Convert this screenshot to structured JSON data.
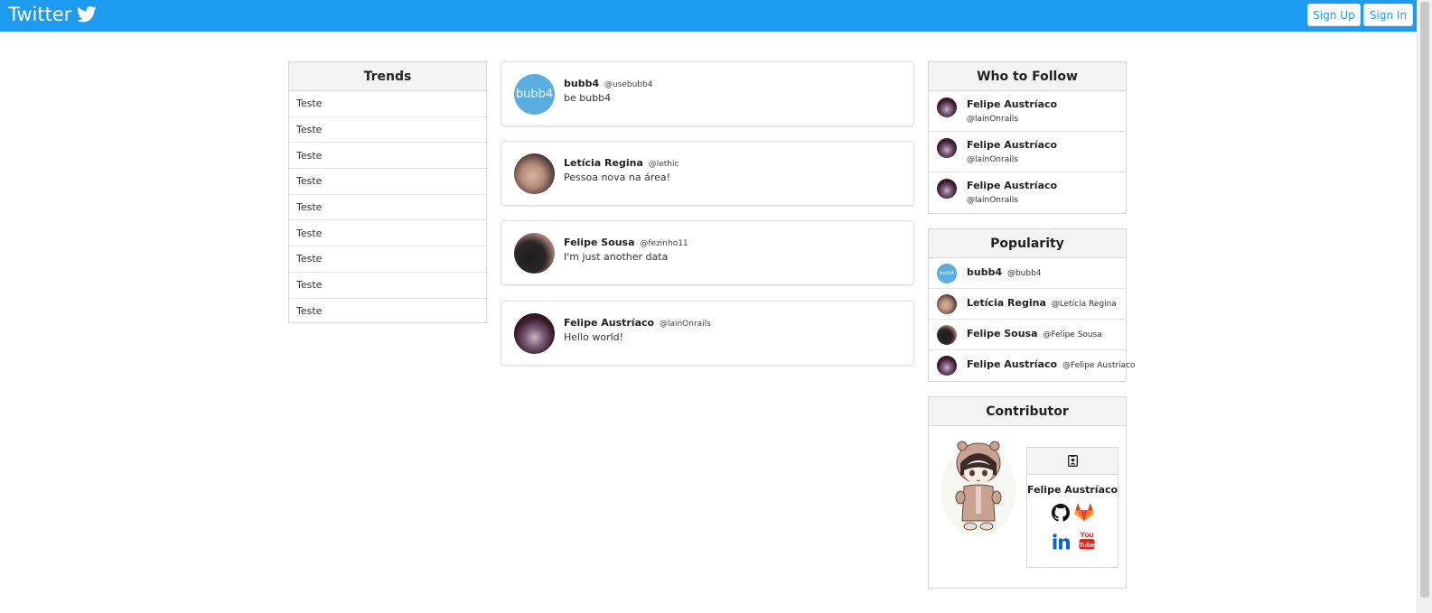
{
  "navbar": {
    "brand": "Twitter",
    "brand_icon": "twitter-bird-icon",
    "signup_label": "Sign Up",
    "signin_label": "Sign In"
  },
  "trends": {
    "title": "Trends",
    "items": [
      "Teste",
      "Teste",
      "Teste",
      "Teste",
      "Teste",
      "Teste",
      "Teste",
      "Teste",
      "Teste"
    ]
  },
  "tweets": [
    {
      "name": "bubb4",
      "handle": "@usebubb4",
      "text": "be bubb4",
      "avatar_text": "bubb4"
    },
    {
      "name": "Letícia Regina",
      "handle": "@lethic",
      "text": "Pessoa nova na área!"
    },
    {
      "name": "Felipe Sousa",
      "handle": "@fezinho11",
      "text": "I'm just another data"
    },
    {
      "name": "Felipe Austríaco",
      "handle": "@lainOnrails",
      "text": "Hello world!"
    }
  ],
  "who_to_follow": {
    "title": "Who to Follow",
    "items": [
      {
        "name": "Felipe Austríaco",
        "handle": "@lainOnrails"
      },
      {
        "name": "Felipe Austríaco",
        "handle": "@lainOnrails"
      },
      {
        "name": "Felipe Austríaco",
        "handle": "@lainOnrails"
      }
    ]
  },
  "popularity": {
    "title": "Popularity",
    "items": [
      {
        "name": "bubb4",
        "handle": "@bubb4"
      },
      {
        "name": "Letícia Regina",
        "handle": "@Letícia Regina"
      },
      {
        "name": "Felipe Sousa",
        "handle": "@Felipe Sousa"
      },
      {
        "name": "Felipe Austríaco",
        "handle": "@Felipe Austríaco"
      }
    ]
  },
  "contributor": {
    "title": "Contributor",
    "card_icon": "contact-card-icon",
    "name": "Felipe Austríaco",
    "socials": [
      "github-icon",
      "gitlab-icon",
      "linkedin-icon",
      "youtube-icon"
    ],
    "youtube_label_top": "You",
    "youtube_label_bottom": "Tube"
  },
  "colors": {
    "brand": "#1d9bf0",
    "panel_header": "#f4f4f4",
    "border": "#d6d6d6",
    "bubb4_avatar": "#5aade0",
    "gitlab": "#e24329",
    "linkedin": "#0a66c2",
    "youtube": "#e62117"
  }
}
